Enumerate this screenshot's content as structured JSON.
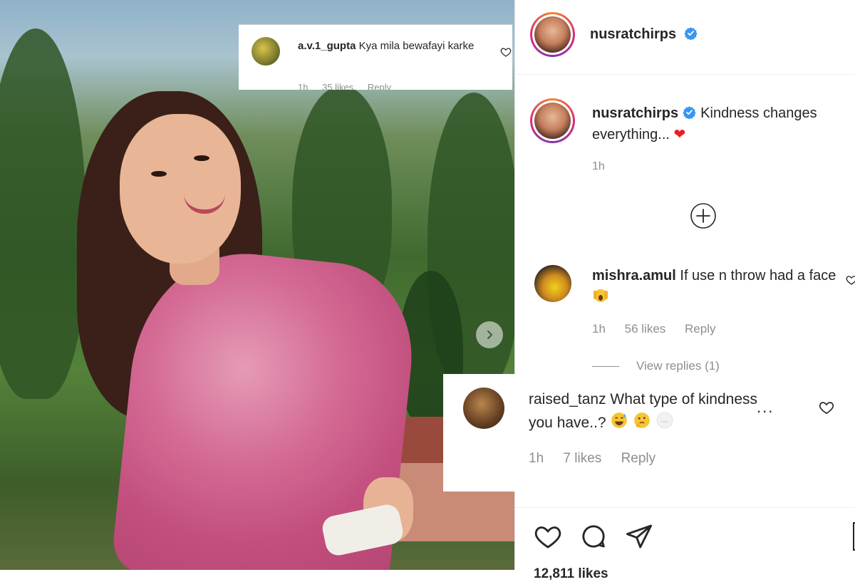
{
  "post": {
    "author": "nusratchirps",
    "caption_text": "Kindness changes everything...",
    "caption_emoji": "❤",
    "time_ago": "1h",
    "likes_text": "12,811 likes"
  },
  "overlay_top_comment": {
    "username": "a.v.1_gupta",
    "text": "Kya mila bewafayi karke",
    "time": "1h",
    "likes": "35 likes",
    "reply_label": "Reply"
  },
  "comments": [
    {
      "username": "mishra.amul",
      "text": "If use n throw had a face",
      "time": "1h",
      "likes": "56 likes",
      "reply_label": "Reply",
      "view_replies": "View replies (1)"
    }
  ],
  "overlay_bottom_comment": {
    "username": "raised_tanz",
    "text": "What type of kindness you have..?",
    "time": "1h",
    "likes": "7 likes",
    "reply_label": "Reply",
    "more": "..."
  },
  "icons": {
    "verified": "verified-badge-icon",
    "add_comments": "plus-circle-icon",
    "like": "heart-icon",
    "comment": "comment-bubble-icon",
    "share": "paper-plane-icon",
    "carousel_next": "chevron-right-icon"
  },
  "colors": {
    "verified_blue": "#3897f0",
    "secondary_text": "#8e8e8e",
    "heart_red": "#ed1c24"
  }
}
